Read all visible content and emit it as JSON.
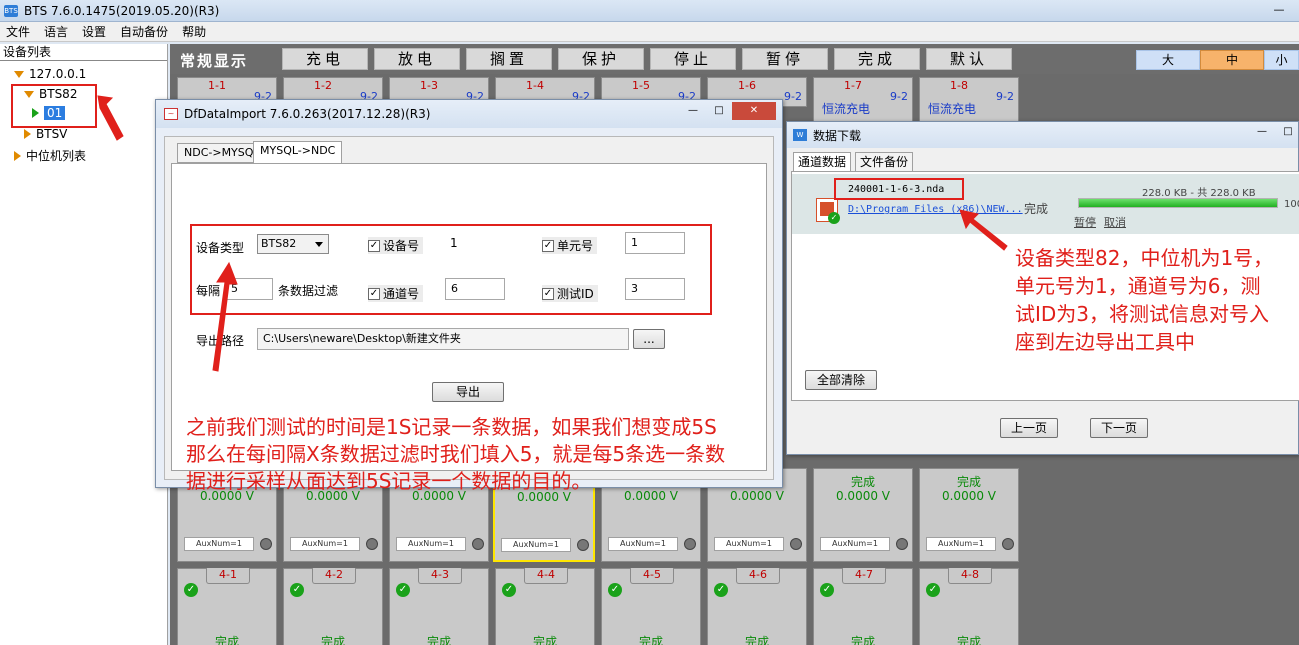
{
  "app": {
    "title": "BTS 7.6.0.1475(2019.05.20)(R3)",
    "icon_label": "BTS",
    "menu": [
      "文件",
      "语言",
      "设置",
      "自动备份",
      "帮助"
    ]
  },
  "tree": {
    "header": "设备列表",
    "nodes": {
      "ip": "127.0.0.1",
      "bts82": "BTS82",
      "unit01": "01",
      "btsv": "BTSV",
      "midlist": "中位机列表"
    }
  },
  "topbar": {
    "regular": "常规显示",
    "buttons": [
      "充电",
      "放电",
      "搁置",
      "保护",
      "停止",
      "暂停",
      "完成",
      "默认"
    ],
    "sizes": [
      "大",
      "中",
      "小"
    ],
    "active_size": "中"
  },
  "grid": {
    "row1": [
      {
        "id": "1-1",
        "sub": "9-2"
      },
      {
        "id": "1-2",
        "sub": "9-2"
      },
      {
        "id": "1-3",
        "sub": "9-2"
      },
      {
        "id": "1-4",
        "sub": "9-2"
      },
      {
        "id": "1-5",
        "sub": "9-2"
      },
      {
        "id": "1-6",
        "sub": "9-2"
      },
      {
        "id": "1-7",
        "sub": "9-2",
        "state": "恒流充电"
      },
      {
        "id": "1-8",
        "sub": "9-2",
        "state": "恒流充电"
      }
    ],
    "row3": [
      {
        "state": "",
        "volt": "0.0000 V",
        "aux": "AuxNum=1"
      },
      {
        "state": "",
        "volt": "0.0000 V",
        "aux": "AuxNum=1"
      },
      {
        "state": "",
        "volt": "0.0000 V",
        "aux": "AuxNum=1"
      },
      {
        "state": "",
        "volt": "0.0000 V",
        "aux": "AuxNum=1"
      },
      {
        "state": "",
        "volt": "0.0000 V",
        "aux": "AuxNum=1"
      },
      {
        "state": "",
        "volt": "0.0000 V",
        "aux": "AuxNum=1"
      },
      {
        "state": "完成",
        "volt": "0.0000 V",
        "aux": "AuxNum=1"
      },
      {
        "state": "完成",
        "volt": "0.0000 V",
        "aux": "AuxNum=1"
      }
    ],
    "row4": [
      {
        "id": "4-1",
        "state": "完成"
      },
      {
        "id": "4-2",
        "state": "完成"
      },
      {
        "id": "4-3",
        "state": "完成"
      },
      {
        "id": "4-4",
        "state": "完成"
      },
      {
        "id": "4-5",
        "state": "完成"
      },
      {
        "id": "4-6",
        "state": "完成"
      },
      {
        "id": "4-7",
        "state": "完成"
      },
      {
        "id": "4-8",
        "state": "完成"
      }
    ]
  },
  "import_dialog": {
    "title": "DfDataImport 7.6.0.263(2017.12.28)(R3)",
    "tabs": [
      "NDC->MYSQL",
      "MYSQL->NDC"
    ],
    "active_tab": "MYSQL->NDC",
    "device_type_label": "设备类型",
    "device_type_value": "BTS82",
    "device_no_label": "设备号",
    "device_no_value": "1",
    "unit_no_label": "单元号",
    "unit_no_value": "1",
    "interval_label": "每隔",
    "interval_value": "5",
    "filter_label": "条数据过滤",
    "channel_label": "通道号",
    "channel_value": "6",
    "test_id_label": "测试ID",
    "test_id_value": "3",
    "export_path_label": "导出路径",
    "export_path_value": "C:\\Users\\neware\\Desktop\\新建文件夹",
    "browse_label": "...",
    "export_button": "导出"
  },
  "download_dialog": {
    "title": "数据下载",
    "tabs": [
      "通道数据",
      "文件备份"
    ],
    "file_name": "240001-1-6-3.nda",
    "file_path": "D:\\Program Files (x86)\\NEW...",
    "status": "完成",
    "size_text": "228.0 KB - 共 228.0 KB",
    "percent_text": "100",
    "progress": 1.0,
    "pause": "暂停",
    "cancel": "取消",
    "clear_all": "全部清除",
    "prev_page": "上一页",
    "next_page": "下一页"
  },
  "annotations": {
    "left_note": [
      "之前我们测试的时间是1S记录一条数据，如果我们想变成5S",
      "那么在每间隔X条数据过滤时我们填入5，就是每5条选一条数",
      "据进行采样从面达到5S记录一个数据的目的。"
    ],
    "right_note": [
      "设备类型82，中位机为1号，",
      "单元号为1，通道号为6，测",
      "试ID为3，将测试信息对号入",
      "座到左边导出工具中"
    ]
  }
}
